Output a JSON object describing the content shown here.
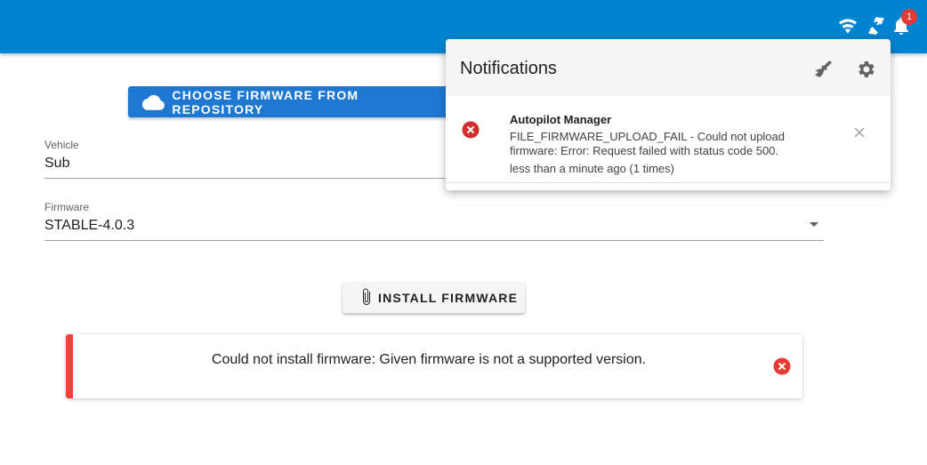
{
  "app_bar": {
    "icons": [
      "wifi-icon",
      "plug-disconnected-icon",
      "bell-icon"
    ],
    "notification_count": "1",
    "color": "#0184d0"
  },
  "main": {
    "repo_button_label": "CHOOSE FIRMWARE FROM REPOSITORY",
    "vehicle": {
      "label": "Vehicle",
      "value": "Sub"
    },
    "firmware": {
      "label": "Firmware",
      "value": "STABLE-4.0.3"
    },
    "install_button_label": "INSTALL FIRMWARE",
    "alert_text": "Could not install firmware: Given firmware is not a supported version."
  },
  "notifications": {
    "title": "Notifications",
    "items": [
      {
        "source": "Autopilot Manager",
        "message": "FILE_FIRMWARE_UPLOAD_FAIL - Could not upload firmware: Error: Request failed with status code 500.",
        "time": "less than a minute ago (1 times)"
      }
    ]
  },
  "colors": {
    "accent": "#1e78d2",
    "error": "#f44336",
    "error_icon": "#d32f2f"
  }
}
